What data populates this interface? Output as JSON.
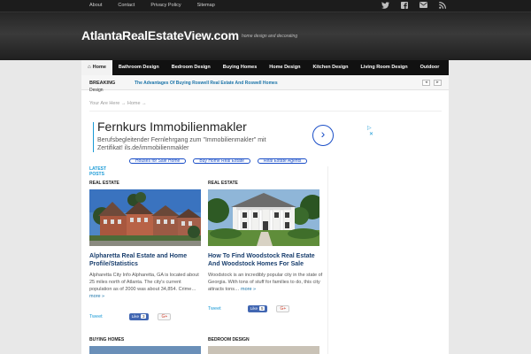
{
  "topbar": {
    "links": [
      "About",
      "Contact",
      "Privacy Policy",
      "Sitemap"
    ],
    "social_icons": [
      "twitter-icon",
      "facebook-icon",
      "email-icon",
      "rss-icon"
    ]
  },
  "header": {
    "title": "AtlantaRealEstateView.com",
    "description": "home design and decorating"
  },
  "nav": {
    "items": [
      "Home",
      "Bathroom Design",
      "Bedroom Design",
      "Buying Homes",
      "Home Design",
      "Kitchen Design",
      "Living Room Design",
      "Outdoor"
    ]
  },
  "breaking": {
    "label": "BREAKING",
    "headline": "The Advantages Of Buying Roswell Real Estate And Roswell Homes",
    "under": "Design"
  },
  "breadcrumb": "Your Are Here → Home →",
  "ad": {
    "title": "Fernkurs Immobilienmakler",
    "line1": "Berufsbegleitender Fernlehrgang zum \"Immobilienmakler\" mit",
    "line2": "Zertifikat! ils.de/immobilienmakler",
    "pills": [
      "Houses for Sale Home",
      "Buy Home Real Estate",
      "Real Estate Agents"
    ],
    "go_symbol": "›",
    "info_symbol": "▷",
    "close_symbol": "✕"
  },
  "latest_label_1": "LATEST",
  "latest_label_2": "POSTS",
  "posts": [
    {
      "category": "REAL ESTATE",
      "title": "Alpharetta Real Estate and Home Profile/Statistics",
      "excerpt": "Alpharetta City Info Alpharetta, GA is located about 25 miles north of Atlanta. The city's current population as of 2000 was about 34,854. Crime…",
      "more": "more »",
      "tweet": "Tweet",
      "fb_label": "Like",
      "fb_count": "3",
      "gplus": "G+"
    },
    {
      "category": "REAL ESTATE",
      "title": "How To Find Woodstock Real Estate And Woodstock Homes For Sale",
      "excerpt": "Woodstock is an incredibly popular city in the state of Georgia. With tons of stuff for families to do, this city attracts tons…",
      "more": "more »",
      "tweet": "Tweet",
      "fb_label": "Like",
      "fb_count": "5",
      "gplus": "G+"
    },
    {
      "category": "BUYING HOMES"
    },
    {
      "category": "BEDROOM DESIGN"
    }
  ],
  "colors": {
    "accent": "#1a9ad6",
    "title_link": "#1a3f6e",
    "nav_bg": "#111111"
  }
}
